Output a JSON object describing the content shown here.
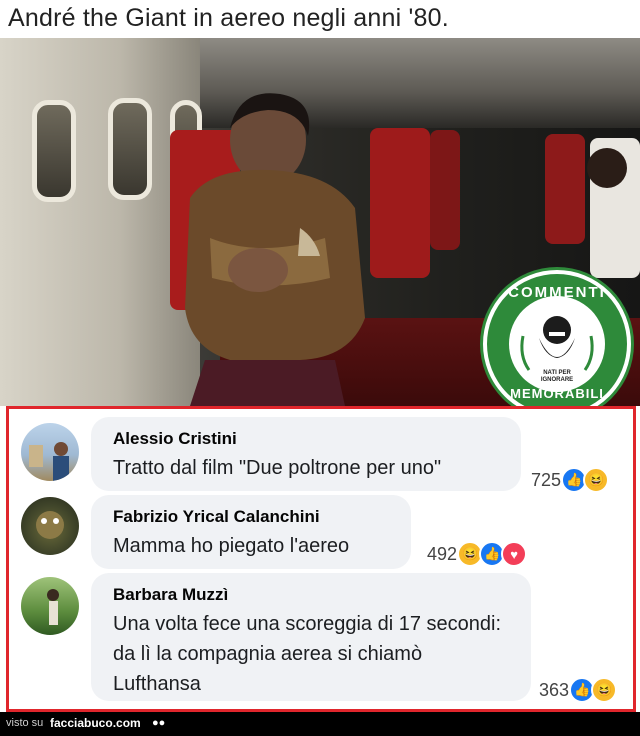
{
  "title": "André the Giant in aereo negli anni '80.",
  "badge": {
    "top": "COMMENTI",
    "bottom": "MEMORABILI",
    "mini": "NATI PER IGNORARE"
  },
  "comments": [
    {
      "name": "Alessio Cristini",
      "text": "Tratto dal film \"Due poltrone per uno\"",
      "count": "725",
      "reactions": [
        "like-icon",
        "haha-icon"
      ]
    },
    {
      "name": "Fabrizio Yrical Calanchini",
      "text": "Mamma ho piegato l'aereo",
      "count": "492",
      "reactions": [
        "haha-icon",
        "like-icon",
        "love-icon"
      ]
    },
    {
      "name": "Barbara Muzzì",
      "text": "Una volta fece una scoreggia di 17 secondi: da lì la compagnia aerea si chiamò Lufthansa",
      "count": "363",
      "reactions": [
        "like-icon",
        "haha-icon"
      ]
    }
  ],
  "footer": {
    "visto": "visto su",
    "site": "facciabuco.com"
  },
  "colors": {
    "frame": "#e0262c",
    "badge": "#2e8a3a",
    "bubble": "#f0f2f5",
    "like": "#1877f2",
    "haha": "#f7b928",
    "love": "#f33e58"
  }
}
